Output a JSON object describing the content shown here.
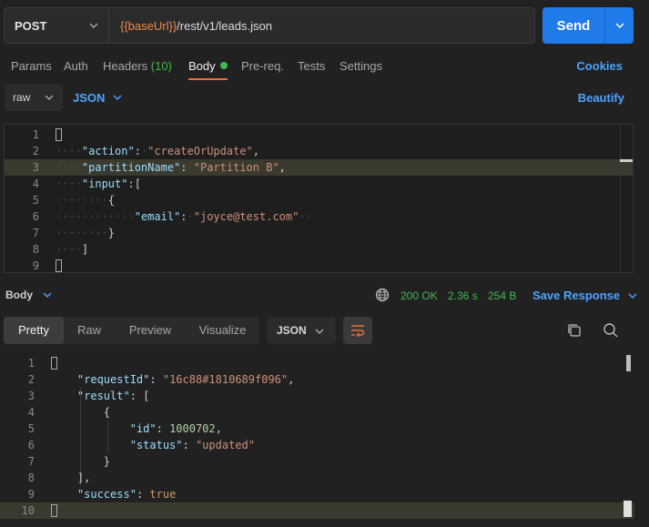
{
  "request": {
    "method": "POST",
    "url_var": "{{baseUrl}}",
    "url_path": "/rest/v1/leads.json",
    "send_label": "Send"
  },
  "tabs": [
    {
      "label": "Params"
    },
    {
      "label": "Auth"
    },
    {
      "label": "Headers",
      "count": "(10)"
    },
    {
      "label": "Body"
    },
    {
      "label": "Pre-req."
    },
    {
      "label": "Tests"
    },
    {
      "label": "Settings"
    }
  ],
  "cookies_label": "Cookies",
  "body_type": {
    "mode": "raw",
    "language": "JSON",
    "beautify_label": "Beautify"
  },
  "request_body_lines": [
    {
      "n": "1",
      "text": "{"
    },
    {
      "n": "2",
      "key": "\"action\"",
      "value": "\"createOrUpdate\""
    },
    {
      "n": "3",
      "key": "\"partitionName\"",
      "value": "\"Partition B\""
    },
    {
      "n": "4",
      "key": "\"input\"",
      "value": "["
    },
    {
      "n": "5",
      "text": "{"
    },
    {
      "n": "6",
      "key": "\"email\"",
      "value": "\"joyce@test.com\""
    },
    {
      "n": "7",
      "text": "}"
    },
    {
      "n": "8",
      "text": "]"
    },
    {
      "n": "9",
      "text": "}"
    }
  ],
  "response": {
    "section_label": "Body",
    "status": "200 OK",
    "time": "2.36 s",
    "size": "254 B",
    "save_label": "Save Response",
    "view_tabs": [
      "Pretty",
      "Raw",
      "Preview",
      "Visualize"
    ],
    "format": "JSON"
  },
  "response_body_lines": [
    {
      "n": "1",
      "text": "{"
    },
    {
      "n": "2",
      "key": "\"requestId\"",
      "value": "\"16c88#1810689f096\""
    },
    {
      "n": "3",
      "key": "\"result\"",
      "value": "["
    },
    {
      "n": "4",
      "text": "{"
    },
    {
      "n": "5",
      "key": "\"id\"",
      "value": "1000702"
    },
    {
      "n": "6",
      "key": "\"status\"",
      "value": "\"updated\""
    },
    {
      "n": "7",
      "text": "}"
    },
    {
      "n": "8",
      "text": "],"
    },
    {
      "n": "9",
      "key": "\"success\"",
      "value": "true"
    },
    {
      "n": "10",
      "text": "}"
    }
  ],
  "colors": {
    "accent": "#1f7bea",
    "link": "#4da3ff",
    "success": "#3fb950",
    "tab_underline": "#ef6c37"
  },
  "icons": [
    "chevron-down-icon",
    "status-dot-icon",
    "globe-icon",
    "wrap-lines-icon",
    "copy-icon",
    "search-icon"
  ]
}
